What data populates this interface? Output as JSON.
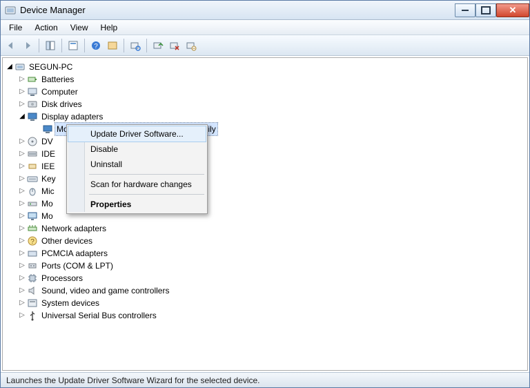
{
  "title": "Device Manager",
  "menu": {
    "file": "File",
    "action": "Action",
    "view": "View",
    "help": "Help"
  },
  "tree": {
    "root": "SEGUN-PC",
    "items": [
      {
        "label": "Batteries",
        "icon": "battery"
      },
      {
        "label": "Computer",
        "icon": "computer"
      },
      {
        "label": "Disk drives",
        "icon": "disk"
      },
      {
        "label": "Display adapters",
        "icon": "display",
        "expanded": true,
        "children": [
          {
            "label": "Mobile Intel(R) 945 Express Chipset Family",
            "icon": "display",
            "selected": true
          }
        ]
      },
      {
        "label": "DV",
        "icon": "dvd"
      },
      {
        "label": "IDE",
        "icon": "ide"
      },
      {
        "label": "IEE",
        "icon": "ieee"
      },
      {
        "label": "Key",
        "icon": "keyboard"
      },
      {
        "label": "Mic",
        "icon": "mouse"
      },
      {
        "label": "Mo",
        "icon": "modem"
      },
      {
        "label": "Mo",
        "icon": "monitor"
      },
      {
        "label": "Network adapters",
        "icon": "network"
      },
      {
        "label": "Other devices",
        "icon": "other"
      },
      {
        "label": "PCMCIA adapters",
        "icon": "pcmcia"
      },
      {
        "label": "Ports (COM & LPT)",
        "icon": "port"
      },
      {
        "label": "Processors",
        "icon": "cpu"
      },
      {
        "label": "Sound, video and game controllers",
        "icon": "sound"
      },
      {
        "label": "System devices",
        "icon": "system"
      },
      {
        "label": "Universal Serial Bus controllers",
        "icon": "usb"
      }
    ]
  },
  "context_menu": {
    "update": "Update Driver Software...",
    "disable": "Disable",
    "uninstall": "Uninstall",
    "scan": "Scan for hardware changes",
    "properties": "Properties"
  },
  "status": "Launches the Update Driver Software Wizard for the selected device."
}
